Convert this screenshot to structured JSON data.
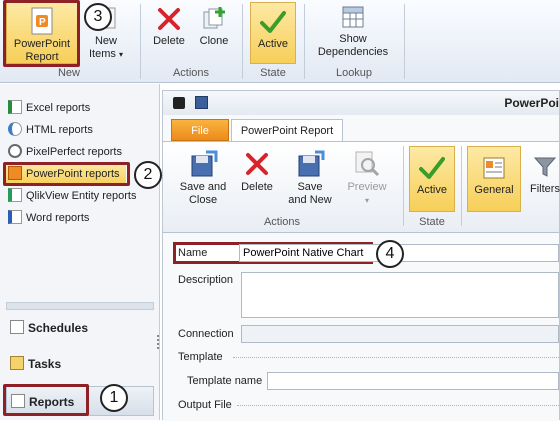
{
  "top_ribbon": {
    "powerpoint_report": "PowerPoint\nReport",
    "new_items": "New\nItems",
    "new_items_arrow": "▾",
    "delete": "Delete",
    "clone": "Clone",
    "active": "Active",
    "show_dependencies": "Show\nDependencies",
    "groups": {
      "new": "New",
      "actions": "Actions",
      "state": "State",
      "lookup": "Lookup"
    }
  },
  "callouts": {
    "c1": "1",
    "c2": "2",
    "c3": "3",
    "c4": "4"
  },
  "sidebar": {
    "items": [
      {
        "label": "Excel reports"
      },
      {
        "label": "HTML reports"
      },
      {
        "label": "PixelPerfect reports"
      },
      {
        "label": "PowerPoint reports"
      },
      {
        "label": "QlikView Entity reports"
      },
      {
        "label": "Word reports"
      }
    ],
    "schedules": "Schedules",
    "tasks": "Tasks",
    "reports": "Reports"
  },
  "document": {
    "title": "PowerPoi",
    "tabs": {
      "file": "File",
      "report": "PowerPoint Report"
    },
    "toolbar": {
      "save_close": "Save and\nClose",
      "delete": "Delete",
      "save_new": "Save\nand New",
      "preview": "Preview",
      "preview_arrow": "▾",
      "active": "Active",
      "general": "General",
      "filters": "Filters",
      "actions_group": "Actions",
      "state_group": "State"
    },
    "form": {
      "name_label": "Name",
      "name_value": "PowerPoint Native Chart",
      "description_label": "Description",
      "connection_label": "Connection",
      "template_label": "Template",
      "template_name_label": "Template name",
      "output_file_label": "Output File"
    }
  },
  "colors": {
    "highlight": "#f7cf58",
    "annotation_red": "#8e2125",
    "delete_red": "#d8232a",
    "check_green": "#3a9d2a"
  }
}
